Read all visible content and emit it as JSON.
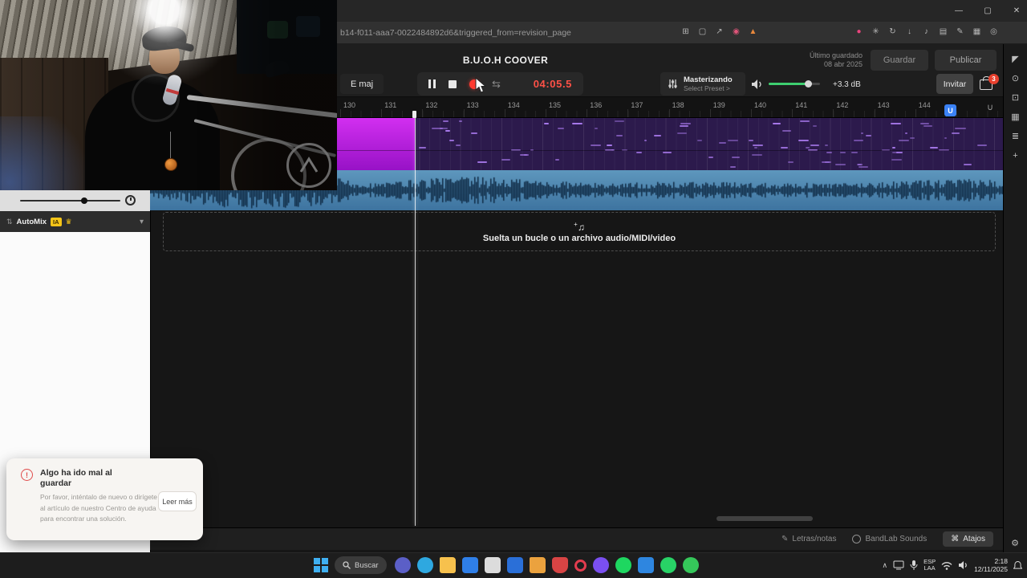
{
  "browser": {
    "url": "b14-f011-aaa7-0022484892d6&triggered_from=revision_page",
    "controls": {
      "minimize": "—",
      "maximize": "▢",
      "close": "✕"
    },
    "mid_icons": [
      {
        "name": "apps-grid-icon",
        "glyph": "⊞"
      },
      {
        "name": "tab-preview-icon",
        "glyph": "▢"
      },
      {
        "name": "share-icon",
        "glyph": "↗"
      },
      {
        "name": "adblock-badge-icon",
        "glyph": "◉",
        "color": "#e0557a"
      },
      {
        "name": "warning-icon",
        "glyph": "▲",
        "color": "#e8883c"
      }
    ],
    "right_icons": [
      {
        "name": "profile-avatar-icon",
        "glyph": "●",
        "color": "#e8447c"
      },
      {
        "name": "extensions-icon",
        "glyph": "✳"
      },
      {
        "name": "history-icon",
        "glyph": "↻"
      },
      {
        "name": "downloads-icon",
        "glyph": "↓"
      },
      {
        "name": "media-control-icon",
        "glyph": "♪"
      },
      {
        "name": "sidebar-icon",
        "glyph": "▤"
      },
      {
        "name": "notes-icon",
        "glyph": "✎"
      },
      {
        "name": "collections-icon",
        "glyph": "▦"
      },
      {
        "name": "find-icon",
        "glyph": "◎"
      }
    ]
  },
  "studio": {
    "title": "B.U.O.H COOVER",
    "last_saved_line1": "Último guardado",
    "last_saved_line2": "08 abr 2025",
    "buttons": {
      "save": "Guardar",
      "publish": "Publicar",
      "invite": "Invitar"
    },
    "key": "E maj",
    "time": "04:05.5",
    "mastering_title": "Masterizando",
    "mastering_subtitle": "Select Preset >",
    "volume_db": "+3.3 dB",
    "cart_badge": "3",
    "collab_badge": "U",
    "ruler": [
      "130",
      "131",
      "132",
      "133",
      "134",
      "135",
      "136",
      "137",
      "138",
      "139",
      "140",
      "141",
      "142",
      "143",
      "144"
    ],
    "rail_icons": [
      {
        "name": "pointer-tool-icon",
        "glyph": "◤"
      },
      {
        "name": "video-icon",
        "glyph": "⊙"
      },
      {
        "name": "display-icon",
        "glyph": "⊡"
      },
      {
        "name": "piano-icon",
        "glyph": "▦"
      },
      {
        "name": "mixer-icon",
        "glyph": "≣"
      },
      {
        "name": "add-track-icon",
        "glyph": "+"
      }
    ],
    "dropzone": "Suelta un bucle o un archivo audio/MIDI/video",
    "bottom": {
      "lyrics": "Letras/notas",
      "sounds": "BandLab Sounds",
      "shortcuts": "Atajos"
    }
  },
  "left_panel": {
    "automix": "AutoMix",
    "ia_badge": "IA"
  },
  "toast": {
    "title": "Algo ha ido mal al guardar",
    "body": "Por favor, inténtalo de nuevo o dirígete al artículo de nuestro Centro de ayuda para encontrar una solución.",
    "action": "Leer más"
  },
  "taskbar": {
    "search": "Buscar",
    "lang1": "ESP",
    "lang2": "LAA",
    "time": "2:18",
    "date": "12/11/2025",
    "apps": [
      {
        "name": "teams",
        "color": "#5b5fc7",
        "shape": "circle"
      },
      {
        "name": "edge",
        "color": "#2ea8e0",
        "shape": "circle"
      },
      {
        "name": "file-explorer",
        "color": "#f7c14d",
        "shape": "folder"
      },
      {
        "name": "store",
        "color": "#2f7fe8",
        "shape": "square"
      },
      {
        "name": "app-light",
        "color": "#dcdcdc",
        "shape": "square"
      },
      {
        "name": "mail",
        "color": "#2a6fd8",
        "shape": "square"
      },
      {
        "name": "folder-orange",
        "color": "#eba23e",
        "shape": "folder"
      },
      {
        "name": "shield-red",
        "color": "#d84444",
        "shape": "shield"
      },
      {
        "name": "opera",
        "color": "#e23c4e",
        "shape": "ring"
      },
      {
        "name": "app-purple",
        "color": "#7a4ff0",
        "shape": "circle"
      },
      {
        "name": "spotify",
        "color": "#1ed760",
        "shape": "circle"
      },
      {
        "name": "app-blue",
        "color": "#2e86e0",
        "shape": "square"
      },
      {
        "name": "whatsapp",
        "color": "#28d366",
        "shape": "circle"
      },
      {
        "name": "app-green",
        "color": "#35c75a",
        "shape": "circle"
      }
    ]
  },
  "icons": {
    "gear": "⚙",
    "crown": "♛",
    "sort": "⇅",
    "chevron_down": "▾",
    "loop": "⇆",
    "command": "⌘",
    "pencil": "✎",
    "note": "♫",
    "plus": "+",
    "snap": "∪",
    "chevron_up": "∧",
    "error": "!"
  }
}
